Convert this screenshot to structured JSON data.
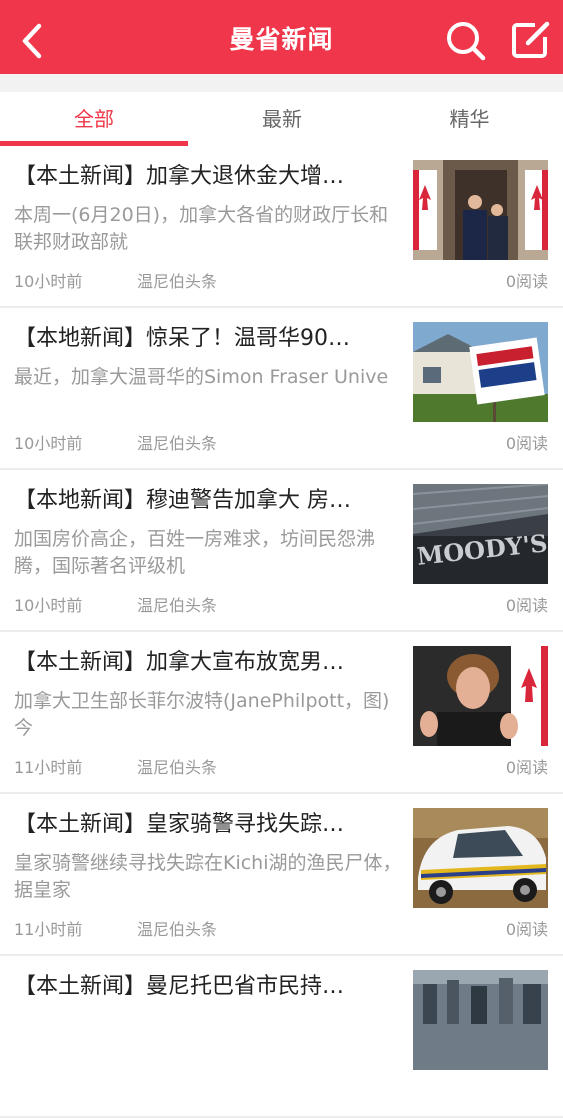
{
  "header": {
    "title": "曼省新闻"
  },
  "tabs": [
    {
      "label": "全部",
      "active": true
    },
    {
      "label": "最新",
      "active": false
    },
    {
      "label": "精华",
      "active": false
    }
  ],
  "colors": {
    "brand": "#f0364a"
  },
  "articles": [
    {
      "headline": "【本土新闻】加拿大退休金大增…",
      "summary": "本周一(6月20日)，加拿大各省的财政厅长和联邦财政部就",
      "time": "10小时前",
      "source": "温尼伯头条",
      "reads": "0阅读",
      "thumb": "politicians-with-flags"
    },
    {
      "headline": "【本地新闻】惊呆了！温哥华90…",
      "summary": "最近，加拿大温哥华的Simon Fraser Unive",
      "time": "10小时前",
      "source": "温尼伯头条",
      "reads": "0阅读",
      "thumb": "for-sale-sign"
    },
    {
      "headline": "【本地新闻】穆迪警告加拿大 房…",
      "summary": "加国房价高企，百姓一房难求，坊间民怨沸腾，国际著名评级机",
      "time": "10小时前",
      "source": "温尼伯头条",
      "reads": "0阅读",
      "thumb": "moodys-building"
    },
    {
      "headline": "【本土新闻】加拿大宣布放宽男…",
      "summary": "加拿大卫生部长菲尔波特(JanePhilpott，图)今",
      "time": "11小时前",
      "source": "温尼伯头条",
      "reads": "0阅读",
      "thumb": "minister-at-podium"
    },
    {
      "headline": "【本土新闻】皇家骑警寻找失踪…",
      "summary": "皇家骑警继续寻找失踪在Kichi湖的渔民尸体，  据皇家",
      "time": "11小时前",
      "source": "温尼伯头条",
      "reads": "0阅读",
      "thumb": "rcmp-car"
    },
    {
      "headline": "【本土新闻】曼尼托巴省市民持…",
      "summary": "",
      "time": "",
      "source": "",
      "reads": "",
      "thumb": "city-aerial"
    }
  ]
}
